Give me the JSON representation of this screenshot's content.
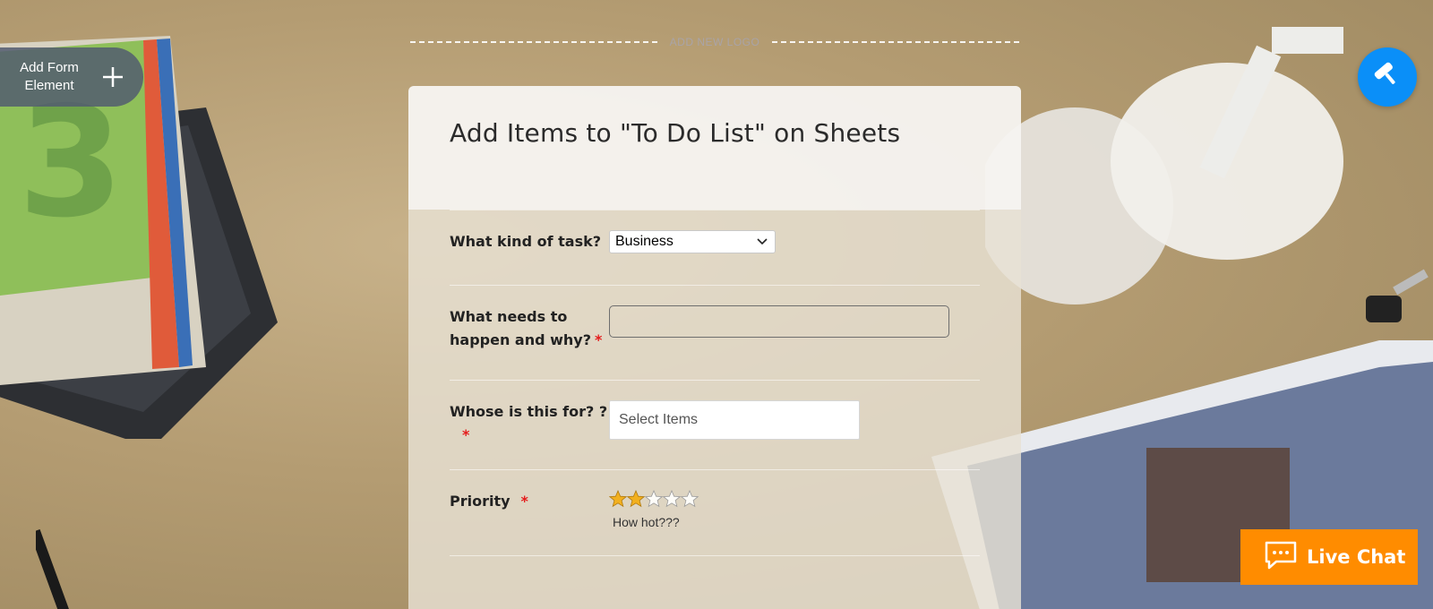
{
  "background": {
    "scene": "desk-photo"
  },
  "divider": {
    "label": "ADD NEW LOGO"
  },
  "add_element": {
    "label": "Add Form Element",
    "icon": "plus-icon"
  },
  "designer_button": {
    "icon": "paint-roller-icon",
    "color": "#0a8ff8"
  },
  "form": {
    "title": "Add Items to \"To Do List\" on Sheets",
    "fields": [
      {
        "label": "What kind of task?",
        "required": false,
        "type": "select",
        "value": "Business"
      },
      {
        "label": "What needs to happen and why?",
        "required": true,
        "required_mark": "*",
        "type": "text",
        "value": ""
      },
      {
        "label": "Whose is this for? ?",
        "required": true,
        "required_mark": "*",
        "type": "multi-select",
        "placeholder": "Select Items"
      },
      {
        "label": "Priority",
        "required": true,
        "required_mark": "*",
        "type": "star-rating",
        "rating": 2,
        "max_rating": 5,
        "sublabel": "How hot???"
      }
    ]
  },
  "live_chat": {
    "label": "Live Chat",
    "icon": "chat-bubble-icon",
    "color": "#ff8c00"
  },
  "colors": {
    "required": "#e41b1b",
    "star_filled": "#f2b01e"
  }
}
